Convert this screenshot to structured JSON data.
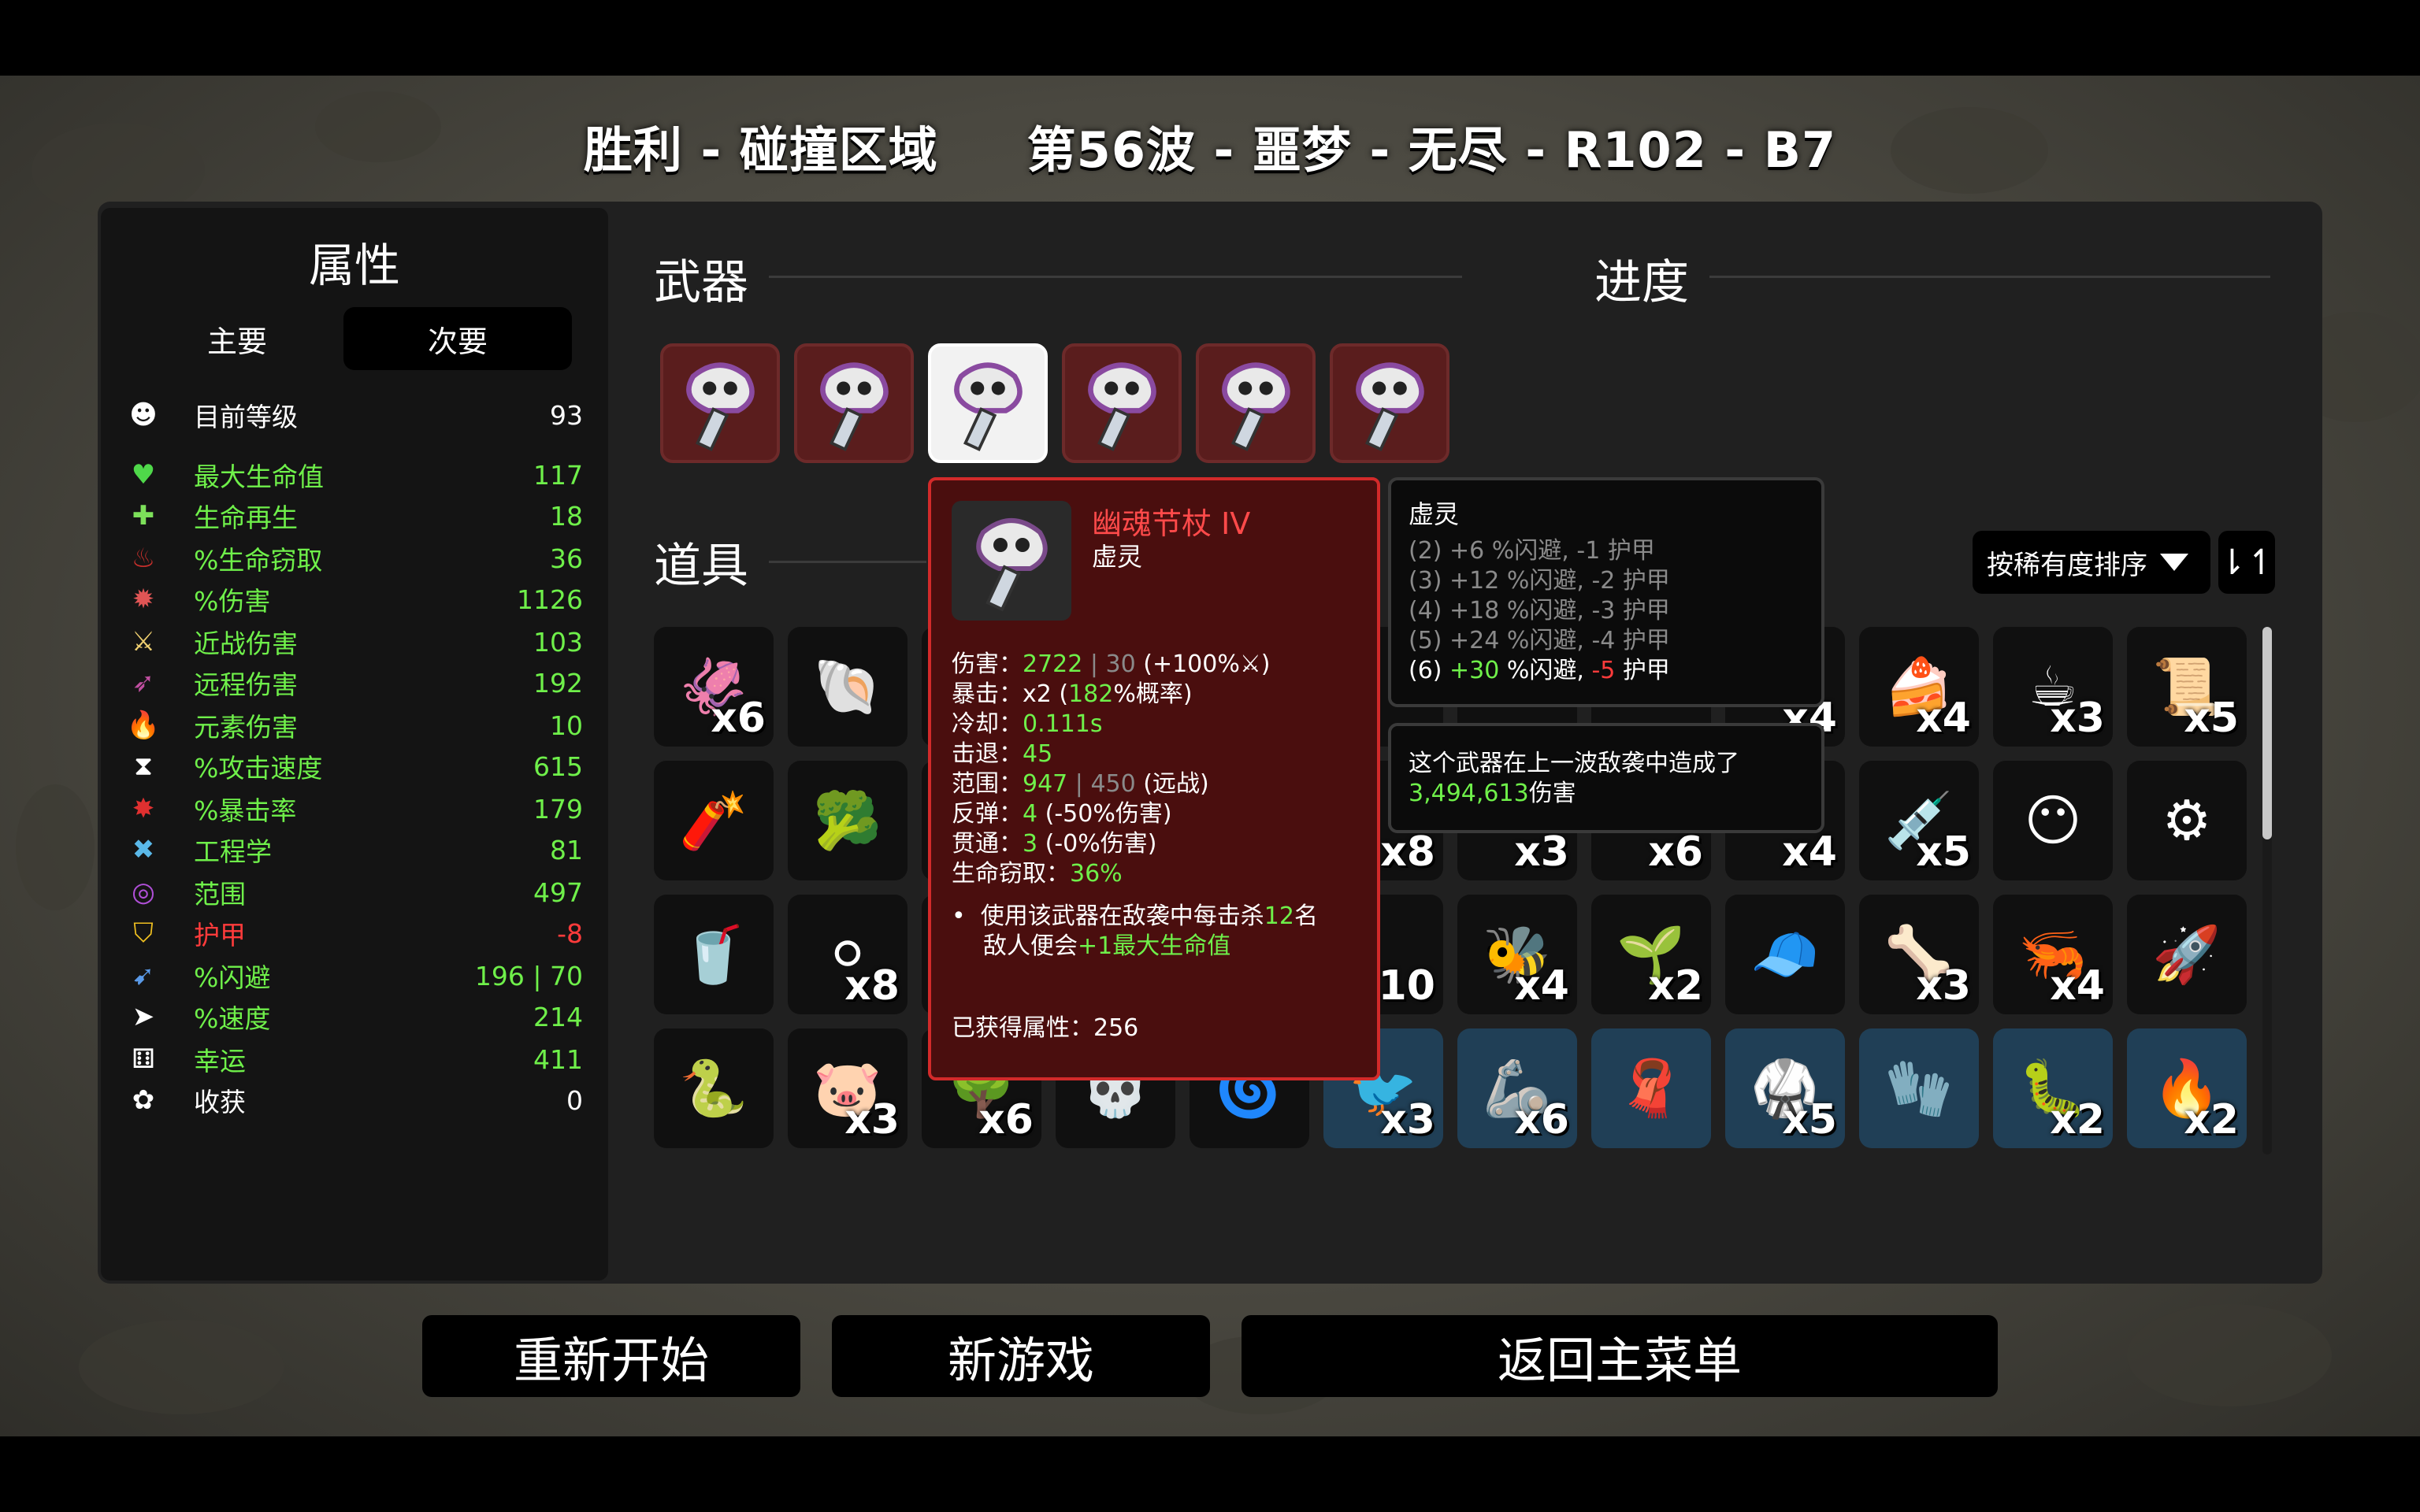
{
  "title": "胜利 - 碰撞区域     第56波 - 噩梦 - 无尽 - R102 - B7",
  "stats": {
    "heading": "属性",
    "tabs": [
      "主要",
      "次要"
    ],
    "rows": [
      {
        "icon": "level-icon",
        "label": "目前等级",
        "value": "93",
        "color": "white"
      },
      {
        "icon": "heart-icon",
        "label": "最大生命值",
        "value": "117",
        "color": "green"
      },
      {
        "icon": "regen-icon",
        "label": "生命再生",
        "value": "18",
        "color": "green"
      },
      {
        "icon": "lifesteal-icon",
        "label": "%生命窃取",
        "value": "36",
        "color": "green"
      },
      {
        "icon": "damage-icon",
        "label": "%伤害",
        "value": "1126",
        "color": "green"
      },
      {
        "icon": "melee-icon",
        "label": "近战伤害",
        "value": "103",
        "color": "green"
      },
      {
        "icon": "ranged-icon",
        "label": "远程伤害",
        "value": "192",
        "color": "green"
      },
      {
        "icon": "elemental-icon",
        "label": "元素伤害",
        "value": "10",
        "color": "green"
      },
      {
        "icon": "attack-speed-icon",
        "label": "%攻击速度",
        "value": "615",
        "color": "green"
      },
      {
        "icon": "crit-icon",
        "label": "%暴击率",
        "value": "179",
        "color": "green"
      },
      {
        "icon": "engineering-icon",
        "label": "工程学",
        "value": "81",
        "color": "green"
      },
      {
        "icon": "range-icon",
        "label": "范围",
        "value": "497",
        "color": "green"
      },
      {
        "icon": "armor-icon",
        "label": "护甲",
        "value": "-8",
        "color": "red"
      },
      {
        "icon": "dodge-icon",
        "label": "%闪避",
        "value": "196 | 70",
        "color": "green"
      },
      {
        "icon": "speed-icon",
        "label": "%速度",
        "value": "214",
        "color": "green"
      },
      {
        "icon": "luck-icon",
        "label": "幸运",
        "value": "411",
        "color": "green"
      },
      {
        "icon": "harvest-icon",
        "label": "收获",
        "value": "0",
        "color": "white"
      }
    ]
  },
  "sections": {
    "weapons": "武器",
    "progress": "进度",
    "items": "道具"
  },
  "sort": {
    "label": "按稀有度排序",
    "order_icon": "⇂↿"
  },
  "weapons_count": 6,
  "items": [
    {
      "icon": "🦑",
      "count": "x6",
      "blue": false
    },
    {
      "icon": "🐚",
      "count": "",
      "blue": false
    },
    {
      "icon": "",
      "count": "",
      "blue": false
    },
    {
      "icon": "",
      "count": "x3",
      "blue": false
    },
    {
      "icon": "",
      "count": "x4",
      "blue": false
    },
    {
      "icon": "",
      "count": "",
      "blue": false
    },
    {
      "icon": "",
      "count": "",
      "blue": false
    },
    {
      "icon": "",
      "count": "",
      "blue": false
    },
    {
      "icon": "",
      "count": "x4",
      "blue": false
    },
    {
      "icon": "🍰",
      "count": "x4",
      "blue": false
    },
    {
      "icon": "☕",
      "count": "x3",
      "blue": false
    },
    {
      "icon": "📜",
      "count": "x5",
      "blue": false
    },
    {
      "icon": "🧨",
      "count": "",
      "blue": false
    },
    {
      "icon": "🥦",
      "count": "",
      "blue": false
    },
    {
      "icon": "",
      "count": "",
      "blue": false
    },
    {
      "icon": "",
      "count": "x6",
      "blue": false
    },
    {
      "icon": "",
      "count": "",
      "blue": false
    },
    {
      "icon": "",
      "count": "x8",
      "blue": false
    },
    {
      "icon": "",
      "count": "x3",
      "blue": false
    },
    {
      "icon": "",
      "count": "x6",
      "blue": false
    },
    {
      "icon": "",
      "count": "x4",
      "blue": false
    },
    {
      "icon": "💉",
      "count": "x5",
      "blue": false
    },
    {
      "icon": "😶",
      "count": "",
      "blue": false
    },
    {
      "icon": "⚙",
      "count": "",
      "blue": false
    },
    {
      "icon": "🥤",
      "count": "",
      "blue": false
    },
    {
      "icon": "⚪",
      "count": "x8",
      "blue": false
    },
    {
      "icon": "",
      "count": "",
      "blue": false
    },
    {
      "icon": "",
      "count": "x3",
      "blue": false
    },
    {
      "icon": "",
      "count": "",
      "blue": false
    },
    {
      "icon": "",
      "count": "10",
      "blue": false
    },
    {
      "icon": "🐝",
      "count": "x4",
      "blue": false
    },
    {
      "icon": "🌱",
      "count": "x2",
      "blue": false
    },
    {
      "icon": "🧢",
      "count": "",
      "blue": false
    },
    {
      "icon": "🦴",
      "count": "x3",
      "blue": false
    },
    {
      "icon": "🦐",
      "count": "x4",
      "blue": false
    },
    {
      "icon": "🚀",
      "count": "",
      "blue": false
    },
    {
      "icon": "🐍",
      "count": "",
      "blue": false
    },
    {
      "icon": "🐷",
      "count": "x3",
      "blue": false
    },
    {
      "icon": "🌳",
      "count": "x6",
      "blue": false
    },
    {
      "icon": "💀",
      "count": "",
      "blue": false
    },
    {
      "icon": "🌀",
      "count": "",
      "blue": false
    },
    {
      "icon": "🐦",
      "count": "x3",
      "blue": true
    },
    {
      "icon": "🦾",
      "count": "x6",
      "blue": true
    },
    {
      "icon": "🧣",
      "count": "",
      "blue": true
    },
    {
      "icon": "🥋",
      "count": "x5",
      "blue": true
    },
    {
      "icon": "🧤",
      "count": "",
      "blue": true
    },
    {
      "icon": "🐛",
      "count": "x2",
      "blue": true
    },
    {
      "icon": "🔥",
      "count": "x2",
      "blue": true
    }
  ],
  "weapon_tooltip": {
    "name": "幽魂节杖 IV",
    "type": "虚灵",
    "lines": [
      {
        "label": "伤害：",
        "value": "2722",
        "extra_grey": " | 30 ",
        "extra": "(+100%⚔)"
      },
      {
        "label": "暴击：",
        "value": "x2 (",
        "value_green": "182",
        "extra": "%概率)"
      },
      {
        "label": "冷却：",
        "value_green": "0.111s"
      },
      {
        "label": "击退：",
        "value_green": "45"
      },
      {
        "label": "范围：",
        "value": "947",
        "extra_grey": " | 450 ",
        "extra": "(远战)"
      },
      {
        "label": "反弹：",
        "value_green": "4",
        "extra": " (-50%伤害)"
      },
      {
        "label": "贯通：",
        "value_green": "3",
        "extra": " (-0%伤害)"
      },
      {
        "label": "生命窃取：",
        "value_green": "36%"
      }
    ],
    "effect_1": "使用该武器在敌袭中每击杀",
    "effect_num": "12",
    "effect_2": "名",
    "effect_3": "敌人便会",
    "effect_green": "+1最大生命值",
    "gained_label": "已获得属性：",
    "gained_value": "256"
  },
  "set_tooltip": {
    "title": "虚灵",
    "lines": [
      "(2) +6 %闪避, -1 护甲",
      "(3) +12 %闪避, -2 护甲",
      "(4) +18 %闪避, -3 护甲",
      "(5) +24 %闪避, -4 护甲"
    ],
    "active_prefix": "(6) ",
    "active_dodge": "+30",
    "active_mid": " %闪避, ",
    "active_armor": "-5",
    "active_suffix": " 护甲"
  },
  "damage_tooltip": {
    "line1": "这个武器在上一波敌袭中造成了",
    "value": "3,494,613",
    "suffix": "伤害"
  },
  "buttons": {
    "restart": "重新开始",
    "new_game": "新游戏",
    "main_menu": "返回主菜单"
  },
  "colors": {
    "green": "#6ff04a",
    "red": "#ff3b3b",
    "weapon_slot": "#5a1d1d",
    "tooltip_border": "#d22a2a",
    "blue_item": "#203f56"
  }
}
